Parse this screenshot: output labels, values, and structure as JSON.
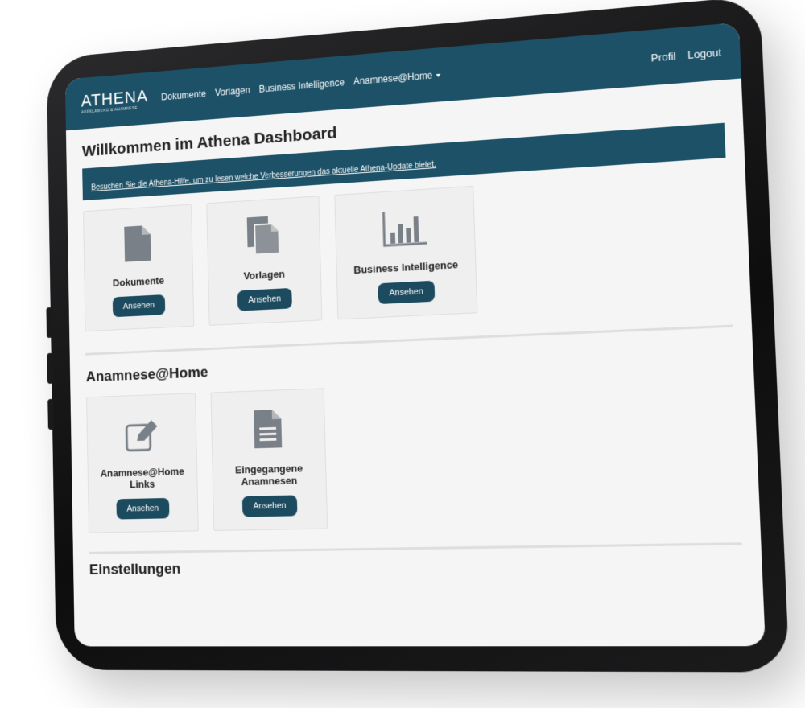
{
  "navbar": {
    "brand_name": "ATHENA",
    "brand_subtitle": "AUFKLÄRUNG & ANAMNESE",
    "links": [
      "Dokumente",
      "Vorlagen",
      "Business Intelligence",
      "Anamnese@Home"
    ],
    "profile": "Profil",
    "logout": "Logout"
  },
  "main": {
    "title": "Willkommen im Athena Dashboard",
    "alert_text": "Besuchen Sie die Athena-Hilfe, um zu lesen welche Verbesserungen das aktuelle Athena-Update bietet.",
    "cards": [
      {
        "title": "Dokumente",
        "button": "Ansehen",
        "icon": "document-icon"
      },
      {
        "title": "Vorlagen",
        "button": "Ansehen",
        "icon": "templates-icon"
      },
      {
        "title": "Business Intelligence",
        "button": "Ansehen",
        "icon": "bar-chart-icon"
      }
    ]
  },
  "anamnese": {
    "title": "Anamnese@Home",
    "cards": [
      {
        "title": "Anamnese@Home Links",
        "button": "Ansehen",
        "icon": "edit-icon"
      },
      {
        "title": "Eingegangene Anamnesen",
        "button": "Ansehen",
        "icon": "text-document-icon"
      }
    ]
  },
  "settings": {
    "title": "Einstellungen"
  },
  "colors": {
    "primary": "#1c5167",
    "button": "#1c4a5e",
    "icon": "#7a8088"
  }
}
